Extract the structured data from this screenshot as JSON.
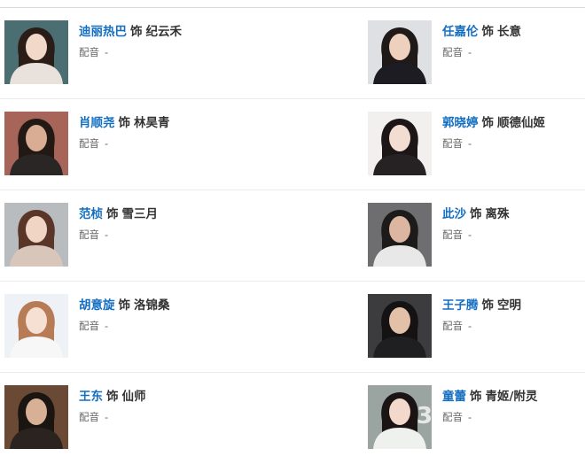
{
  "cast": [
    {
      "actor": "迪丽热巴",
      "role_word": "饰",
      "role": "纪云禾",
      "dub_label": "配音",
      "dub_value": "-",
      "photo": {
        "bg": "#4a6e72",
        "face": "#f1d8c9",
        "hair": "#2a1d18",
        "clothes": "#e9e2dc"
      }
    },
    {
      "actor": "任嘉伦",
      "role_word": "饰",
      "role": "长意",
      "dub_label": "配音",
      "dub_value": "-",
      "photo": {
        "bg": "#dfe0e4",
        "face": "#edd0bd",
        "hair": "#1f1a18",
        "clothes": "#1c1c22"
      }
    },
    {
      "actor": "肖顺尧",
      "role_word": "饰",
      "role": "林昊青",
      "dub_label": "配音",
      "dub_value": "-",
      "photo": {
        "bg": "#a7655a",
        "face": "#d9ad94",
        "hair": "#221814",
        "clothes": "#2b2626"
      }
    },
    {
      "actor": "郭晓婷",
      "role_word": "饰",
      "role": "顺德仙姬",
      "dub_label": "配音",
      "dub_value": "-",
      "photo": {
        "bg": "#f2efef",
        "face": "#f3ddd2",
        "hair": "#1c1616",
        "clothes": "#262224"
      }
    },
    {
      "actor": "范桢",
      "role_word": "饰",
      "role": "雪三月",
      "dub_label": "配音",
      "dub_value": "-",
      "photo": {
        "bg": "#b9bcbe",
        "face": "#f0d4c4",
        "hair": "#5a3628",
        "clothes": "#d9c6ba"
      }
    },
    {
      "actor": "此沙",
      "role_word": "饰",
      "role": "离殊",
      "dub_label": "配音",
      "dub_value": "-",
      "photo": {
        "bg": "#6e6e70",
        "face": "#dcb6a0",
        "hair": "#1d1a1a",
        "clothes": "#e8e8e8"
      }
    },
    {
      "actor": "胡意旋",
      "role_word": "饰",
      "role": "洛锦桑",
      "dub_label": "配音",
      "dub_value": "-",
      "photo": {
        "bg": "#eef1f5",
        "face": "#f6dfd3",
        "hair": "#b77b55",
        "clothes": "#f7f7f7"
      }
    },
    {
      "actor": "王子腾",
      "role_word": "饰",
      "role": "空明",
      "dub_label": "配音",
      "dub_value": "-",
      "photo": {
        "bg": "#3c3c3e",
        "face": "#e3c0a8",
        "hair": "#141212",
        "clothes": "#1f1f22"
      }
    },
    {
      "actor": "王东",
      "role_word": "饰",
      "role": "仙师",
      "dub_label": "配音",
      "dub_value": "-",
      "photo": {
        "bg": "#6a4a34",
        "face": "#d7b095",
        "hair": "#1b1512",
        "clothes": "#2a2320"
      }
    },
    {
      "actor": "童蕾",
      "role_word": "饰",
      "role": "青姬/附灵",
      "dub_label": "配音",
      "dub_value": "-",
      "photo": {
        "bg": "#9aa5a2",
        "face": "#f2d9cb",
        "hair": "#1b1414",
        "clothes": "#eef1ee"
      }
    }
  ]
}
